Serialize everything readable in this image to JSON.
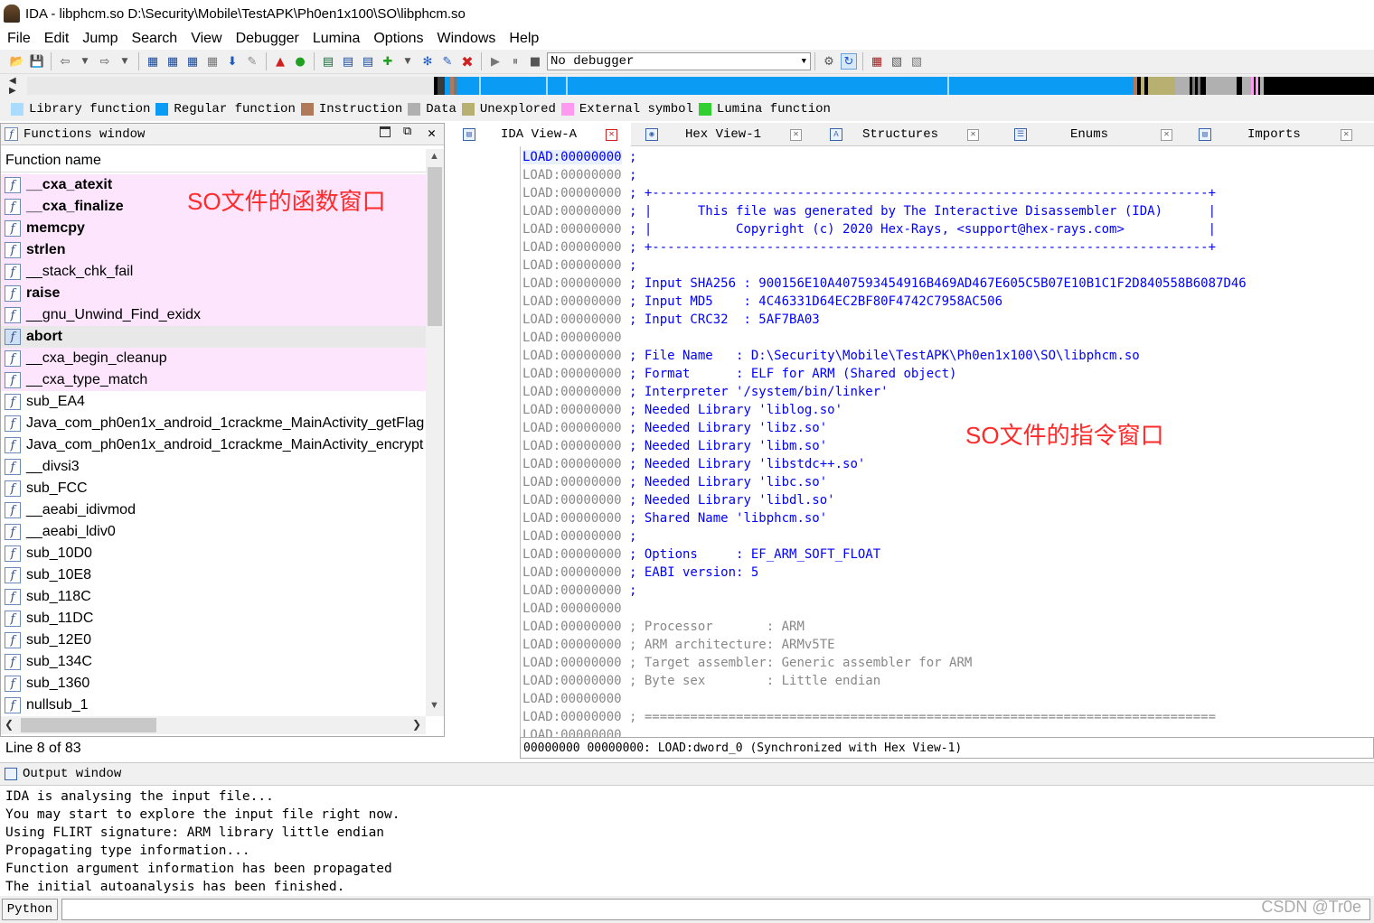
{
  "window": {
    "title": "IDA - libphcm.so D:\\Security\\Mobile\\TestAPK\\Ph0en1x100\\SO\\libphcm.so"
  },
  "menu": [
    "File",
    "Edit",
    "Jump",
    "Search",
    "View",
    "Debugger",
    "Lumina",
    "Options",
    "Windows",
    "Help"
  ],
  "toolbar": {
    "debugger_select": "No debugger"
  },
  "legend": [
    {
      "label": "Library function",
      "color": "#aadcff"
    },
    {
      "label": "Regular function",
      "color": "#0a9bf5"
    },
    {
      "label": "Instruction",
      "color": "#b07a5a"
    },
    {
      "label": "Data",
      "color": "#b0b0b0"
    },
    {
      "label": "Unexplored",
      "color": "#b8b070"
    },
    {
      "label": "External symbol",
      "color": "#ff9af0"
    },
    {
      "label": "Lumina function",
      "color": "#30d030"
    }
  ],
  "functions_window": {
    "title": "Functions window",
    "column": "Function name",
    "status": "Line 8 of 83",
    "annotation": "SO文件的函数窗口",
    "rows": [
      {
        "name": "__cxa_atexit",
        "bold": true,
        "type": "external"
      },
      {
        "name": "__cxa_finalize",
        "bold": true,
        "type": "external"
      },
      {
        "name": "memcpy",
        "bold": true,
        "type": "external"
      },
      {
        "name": "strlen",
        "bold": true,
        "type": "external"
      },
      {
        "name": "__stack_chk_fail",
        "bold": false,
        "type": "external"
      },
      {
        "name": "raise",
        "bold": true,
        "type": "external"
      },
      {
        "name": "__gnu_Unwind_Find_exidx",
        "bold": false,
        "type": "external"
      },
      {
        "name": "abort",
        "bold": true,
        "type": "selected"
      },
      {
        "name": "__cxa_begin_cleanup",
        "bold": false,
        "type": "external"
      },
      {
        "name": "__cxa_type_match",
        "bold": false,
        "type": "external"
      },
      {
        "name": "sub_EA4",
        "bold": false,
        "type": "regular"
      },
      {
        "name": "Java_com_ph0en1x_android_1crackme_MainActivity_getFlag",
        "bold": false,
        "type": "regular"
      },
      {
        "name": "Java_com_ph0en1x_android_1crackme_MainActivity_encrypt",
        "bold": false,
        "type": "regular"
      },
      {
        "name": "__divsi3",
        "bold": false,
        "type": "regular"
      },
      {
        "name": "sub_FCC",
        "bold": false,
        "type": "regular"
      },
      {
        "name": "__aeabi_idivmod",
        "bold": false,
        "type": "regular"
      },
      {
        "name": "__aeabi_ldiv0",
        "bold": false,
        "type": "regular"
      },
      {
        "name": "sub_10D0",
        "bold": false,
        "type": "regular"
      },
      {
        "name": "sub_10E8",
        "bold": false,
        "type": "regular"
      },
      {
        "name": "sub_118C",
        "bold": false,
        "type": "regular"
      },
      {
        "name": "sub_11DC",
        "bold": false,
        "type": "regular"
      },
      {
        "name": "sub_12E0",
        "bold": false,
        "type": "regular"
      },
      {
        "name": "sub_134C",
        "bold": false,
        "type": "regular"
      },
      {
        "name": "sub_1360",
        "bold": false,
        "type": "regular"
      },
      {
        "name": "nullsub_1",
        "bold": false,
        "type": "regular"
      }
    ]
  },
  "tabs": [
    {
      "label": "IDA View-A",
      "active": true
    },
    {
      "label": "Hex View-1",
      "active": false
    },
    {
      "label": "Structures",
      "active": false
    },
    {
      "label": "Enums",
      "active": false
    },
    {
      "label": "Imports",
      "active": false
    }
  ],
  "ida_view": {
    "annotation": "SO文件的指令窗口",
    "status": "00000000 00000000: LOAD:dword_0 (Synchronized with Hex View-1)",
    "lines": [
      {
        "addr": "LOAD:00000000",
        "text": " ;",
        "style": "cmt",
        "current": true
      },
      {
        "addr": "LOAD:00000000",
        "text": " ;",
        "style": "cmt"
      },
      {
        "addr": "LOAD:00000000",
        "text": " ; +-------------------------------------------------------------------------+",
        "style": "cmt"
      },
      {
        "addr": "LOAD:00000000",
        "text": " ; |      This file was generated by The Interactive Disassembler (IDA)      |",
        "style": "cmt"
      },
      {
        "addr": "LOAD:00000000",
        "text": " ; |           Copyright (c) 2020 Hex-Rays, <support@hex-rays.com>           |",
        "style": "cmt"
      },
      {
        "addr": "LOAD:00000000",
        "text": " ; +-------------------------------------------------------------------------+",
        "style": "cmt"
      },
      {
        "addr": "LOAD:00000000",
        "text": " ;",
        "style": "cmt"
      },
      {
        "addr": "LOAD:00000000",
        "text": " ; Input SHA256 : 900156E10A407593454916B469AD467E605C5B07E10B1C1F2D840558B6087D46",
        "style": "cmt"
      },
      {
        "addr": "LOAD:00000000",
        "text": " ; Input MD5    : 4C46331D64EC2BF80F4742C7958AC506",
        "style": "cmt"
      },
      {
        "addr": "LOAD:00000000",
        "text": " ; Input CRC32  : 5AF7BA03",
        "style": "cmt"
      },
      {
        "addr": "LOAD:00000000",
        "text": "",
        "style": "cmt"
      },
      {
        "addr": "LOAD:00000000",
        "text": " ; File Name   : D:\\Security\\Mobile\\TestAPK\\Ph0en1x100\\SO\\libphcm.so",
        "style": "cmt"
      },
      {
        "addr": "LOAD:00000000",
        "text": " ; Format      : ELF for ARM (Shared object)",
        "style": "cmt"
      },
      {
        "addr": "LOAD:00000000",
        "text": " ; Interpreter '/system/bin/linker'",
        "style": "cmt"
      },
      {
        "addr": "LOAD:00000000",
        "text": " ; Needed Library 'liblog.so'",
        "style": "cmt"
      },
      {
        "addr": "LOAD:00000000",
        "text": " ; Needed Library 'libz.so'",
        "style": "cmt"
      },
      {
        "addr": "LOAD:00000000",
        "text": " ; Needed Library 'libm.so'",
        "style": "cmt"
      },
      {
        "addr": "LOAD:00000000",
        "text": " ; Needed Library 'libstdc++.so'",
        "style": "cmt"
      },
      {
        "addr": "LOAD:00000000",
        "text": " ; Needed Library 'libc.so'",
        "style": "cmt"
      },
      {
        "addr": "LOAD:00000000",
        "text": " ; Needed Library 'libdl.so'",
        "style": "cmt"
      },
      {
        "addr": "LOAD:00000000",
        "text": " ; Shared Name 'libphcm.so'",
        "style": "cmt"
      },
      {
        "addr": "LOAD:00000000",
        "text": " ;",
        "style": "cmt"
      },
      {
        "addr": "LOAD:00000000",
        "text": " ; Options     : EF_ARM_SOFT_FLOAT",
        "style": "cmt"
      },
      {
        "addr": "LOAD:00000000",
        "text": " ; EABI version: 5",
        "style": "cmt"
      },
      {
        "addr": "LOAD:00000000",
        "text": " ;",
        "style": "cmt"
      },
      {
        "addr": "LOAD:00000000",
        "text": "",
        "style": "cmt"
      },
      {
        "addr": "LOAD:00000000",
        "text": " ; Processor       : ARM",
        "style": "gcmt"
      },
      {
        "addr": "LOAD:00000000",
        "text": " ; ARM architecture: ARMv5TE",
        "style": "gcmt"
      },
      {
        "addr": "LOAD:00000000",
        "text": " ; Target assembler: Generic assembler for ARM",
        "style": "gcmt"
      },
      {
        "addr": "LOAD:00000000",
        "text": " ; Byte sex        : Little endian",
        "style": "gcmt"
      },
      {
        "addr": "LOAD:00000000",
        "text": "",
        "style": "gcmt"
      },
      {
        "addr": "LOAD:00000000",
        "text": " ; ===========================================================================",
        "style": "gcmt"
      },
      {
        "addr": "LOAD:00000000",
        "text": "",
        "style": "gcmt"
      }
    ]
  },
  "output": {
    "title": "Output window",
    "lines": [
      "IDA is analysing the input file...",
      "You may start to explore the input file right now.",
      "Using FLIRT signature: ARM library little endian",
      "Propagating type information...",
      "Function argument information has been propagated",
      "The initial autoanalysis has been finished."
    ]
  },
  "python": {
    "button": "Python"
  },
  "watermark": "CSDN @Tr0e"
}
